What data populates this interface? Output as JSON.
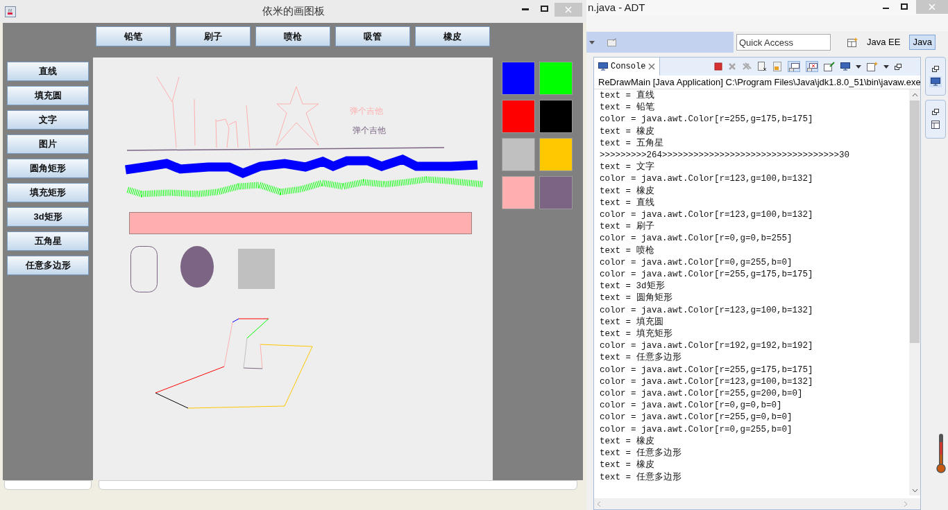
{
  "app_window": {
    "title": "依米的画图板",
    "tools": [
      "铅笔",
      "刷子",
      "喷枪",
      "吸管",
      "橡皮"
    ],
    "shapes": [
      "直线",
      "填充圆",
      "文字",
      "图片",
      "圆角矩形",
      "填充矩形",
      "3d矩形",
      "五角星",
      "任意多边形"
    ],
    "palette": [
      {
        "color": "#0000ff"
      },
      {
        "color": "#00ff00"
      },
      {
        "color": "#ff0000"
      },
      {
        "color": "#000000"
      },
      {
        "color": "#c0c0c0"
      },
      {
        "color": "#ffc800"
      },
      {
        "color": "#ffafaf"
      },
      {
        "color": "#7b6484"
      }
    ],
    "canvas": {
      "texts": [
        {
          "text": "弹个吉他",
          "color": "#ffafaf"
        },
        {
          "text": "弹个吉他",
          "color": "#7b6484"
        }
      ]
    }
  },
  "ide_window": {
    "title": "n.java - ADT",
    "quick_access": {
      "placeholder": "Quick Access"
    },
    "perspectives": [
      {
        "label": "Java EE",
        "selected": false
      },
      {
        "label": "Java",
        "selected": true
      }
    ],
    "console": {
      "tab": "Console",
      "header": "ReDrawMain [Java Application] C:\\Program Files\\Java\\jdk1.8.0_51\\bin\\javaw.exe",
      "lines": [
        "text = 直线",
        "text = 铅笔",
        "color = java.awt.Color[r=255,g=175,b=175]",
        "text = 橡皮",
        "text = 五角星",
        ">>>>>>>>>264>>>>>>>>>>>>>>>>>>>>>>>>>>>>>>>>>>30",
        "text = 文字",
        "color = java.awt.Color[r=123,g=100,b=132]",
        "text = 橡皮",
        "text = 直线",
        "color = java.awt.Color[r=123,g=100,b=132]",
        "text = 刷子",
        "color = java.awt.Color[r=0,g=0,b=255]",
        "text = 喷枪",
        "color = java.awt.Color[r=0,g=255,b=0]",
        "color = java.awt.Color[r=255,g=175,b=175]",
        "text = 3d矩形",
        "text = 圆角矩形",
        "color = java.awt.Color[r=123,g=100,b=132]",
        "text = 填充圆",
        "text = 填充矩形",
        "color = java.awt.Color[r=192,g=192,b=192]",
        "text = 任意多边形",
        "color = java.awt.Color[r=255,g=175,b=175]",
        "color = java.awt.Color[r=123,g=100,b=132]",
        "color = java.awt.Color[r=255,g=200,b=0]",
        "color = java.awt.Color[r=0,g=0,b=0]",
        "color = java.awt.Color[r=255,g=0,b=0]",
        "color = java.awt.Color[r=0,g=255,b=0]",
        "text = 橡皮",
        "text = 任意多边形",
        "text = 橡皮",
        "text = 任意多边形"
      ]
    }
  }
}
